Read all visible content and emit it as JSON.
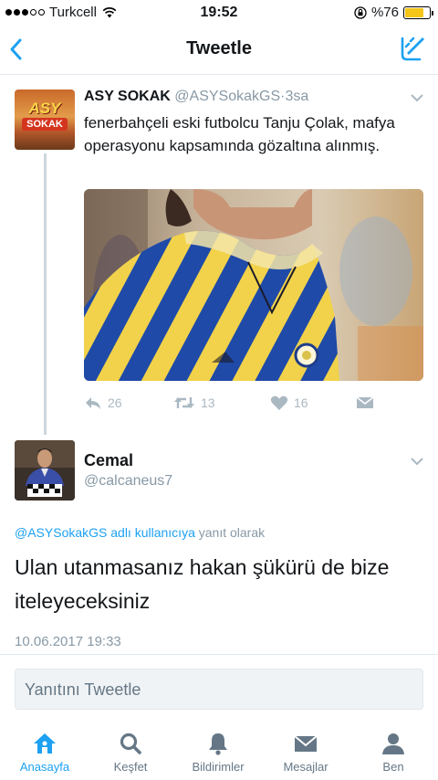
{
  "status_bar": {
    "carrier": "Turkcell",
    "time": "19:52",
    "battery_percent": "%76",
    "battery_level": 0.76
  },
  "nav": {
    "title": "Tweetle",
    "back_icon": "chevron-left-icon",
    "compose_icon": "compose-icon"
  },
  "original_tweet": {
    "name": "ASY SOKAK",
    "handle": "@ASYSokakGS",
    "separator": "·",
    "time": "3sa",
    "avatar_text": [
      "ASY",
      "SOKAK"
    ],
    "text": "fenerbahçeli eski futbolcu Tanju Çolak, mafya operasyonu kapsamında gözaltına alınmış.",
    "actions": {
      "reply_count": "26",
      "retweet_count": "13",
      "like_count": "16"
    }
  },
  "reply_tweet": {
    "name": "Cemal",
    "handle": "@calcaneus7",
    "reply_context_user": "@ASYSokakGS adlı kullanıcıya",
    "reply_context_suffix": " yanıt olarak",
    "text": "Ulan utanmasanız hakan şükürü de bize iteleyeceksiniz",
    "date": "10.06.2017 19:33"
  },
  "reply_box": {
    "placeholder": "Yanıtını Tweetle"
  },
  "tab_bar": {
    "tabs": [
      {
        "label": "Anasayfa",
        "icon": "home-icon",
        "active": true
      },
      {
        "label": "Keşfet",
        "icon": "search-icon",
        "active": false
      },
      {
        "label": "Bildirimler",
        "icon": "bell-icon",
        "active": false
      },
      {
        "label": "Mesajlar",
        "icon": "envelope-icon",
        "active": false
      },
      {
        "label": "Ben",
        "icon": "person-icon",
        "active": false
      }
    ]
  },
  "colors": {
    "accent": "#1da1f2",
    "secondary_text": "#8899a6",
    "action_icons": "#aab8c2",
    "battery": "#f5c518"
  }
}
